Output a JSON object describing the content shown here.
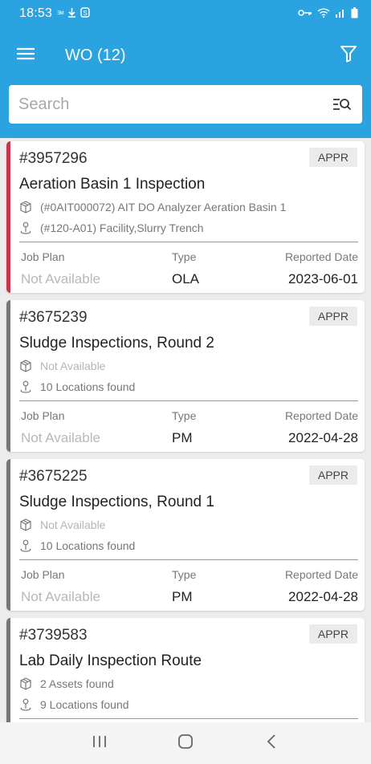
{
  "status_bar": {
    "time": "18:53",
    "left_icons": [
      "ssid-icon",
      "download-icon",
      "shield-icon"
    ],
    "right_icons": [
      "key-icon",
      "wifi-icon",
      "signal-icon",
      "battery-icon"
    ]
  },
  "app_bar": {
    "title": "WO (12)",
    "menu_icon": "menu-icon",
    "filter_icon": "filter-icon"
  },
  "search": {
    "placeholder": "Search",
    "icon": "search-list-icon"
  },
  "labels": {
    "job_plan": "Job Plan",
    "type": "Type",
    "reported_date": "Reported Date"
  },
  "work_orders": [
    {
      "number": "#3957296",
      "status": "APPR",
      "description": "Aeration Basin 1 Inspection",
      "asset": "(#0AIT000072) AIT DO Analyzer Aeration Basin 1",
      "location": "(#120-A01) Facility,Slurry Trench",
      "job_plan": "Not Available",
      "type": "OLA",
      "reported_date": "2023-06-01"
    },
    {
      "number": "#3675239",
      "status": "APPR",
      "description": "Sludge Inspections, Round 2",
      "asset": "Not Available",
      "location": "10 Locations found",
      "job_plan": "Not Available",
      "type": "PM",
      "reported_date": "2022-04-28"
    },
    {
      "number": "#3675225",
      "status": "APPR",
      "description": "Sludge Inspections, Round 1",
      "asset": "Not Available",
      "location": "10 Locations found",
      "job_plan": "Not Available",
      "type": "PM",
      "reported_date": "2022-04-28"
    },
    {
      "number": "#3739583",
      "status": "APPR",
      "description": "Lab Daily Inspection Route",
      "asset": "2 Assets found",
      "location": "9 Locations found"
    }
  ],
  "nav_bar": {
    "recents_icon": "recents-icon",
    "home_icon": "home-icon",
    "back_icon": "back-icon"
  },
  "colors": {
    "primary": "#2aa3e0",
    "priority_accent": "#c8334a",
    "default_accent": "#777777"
  }
}
